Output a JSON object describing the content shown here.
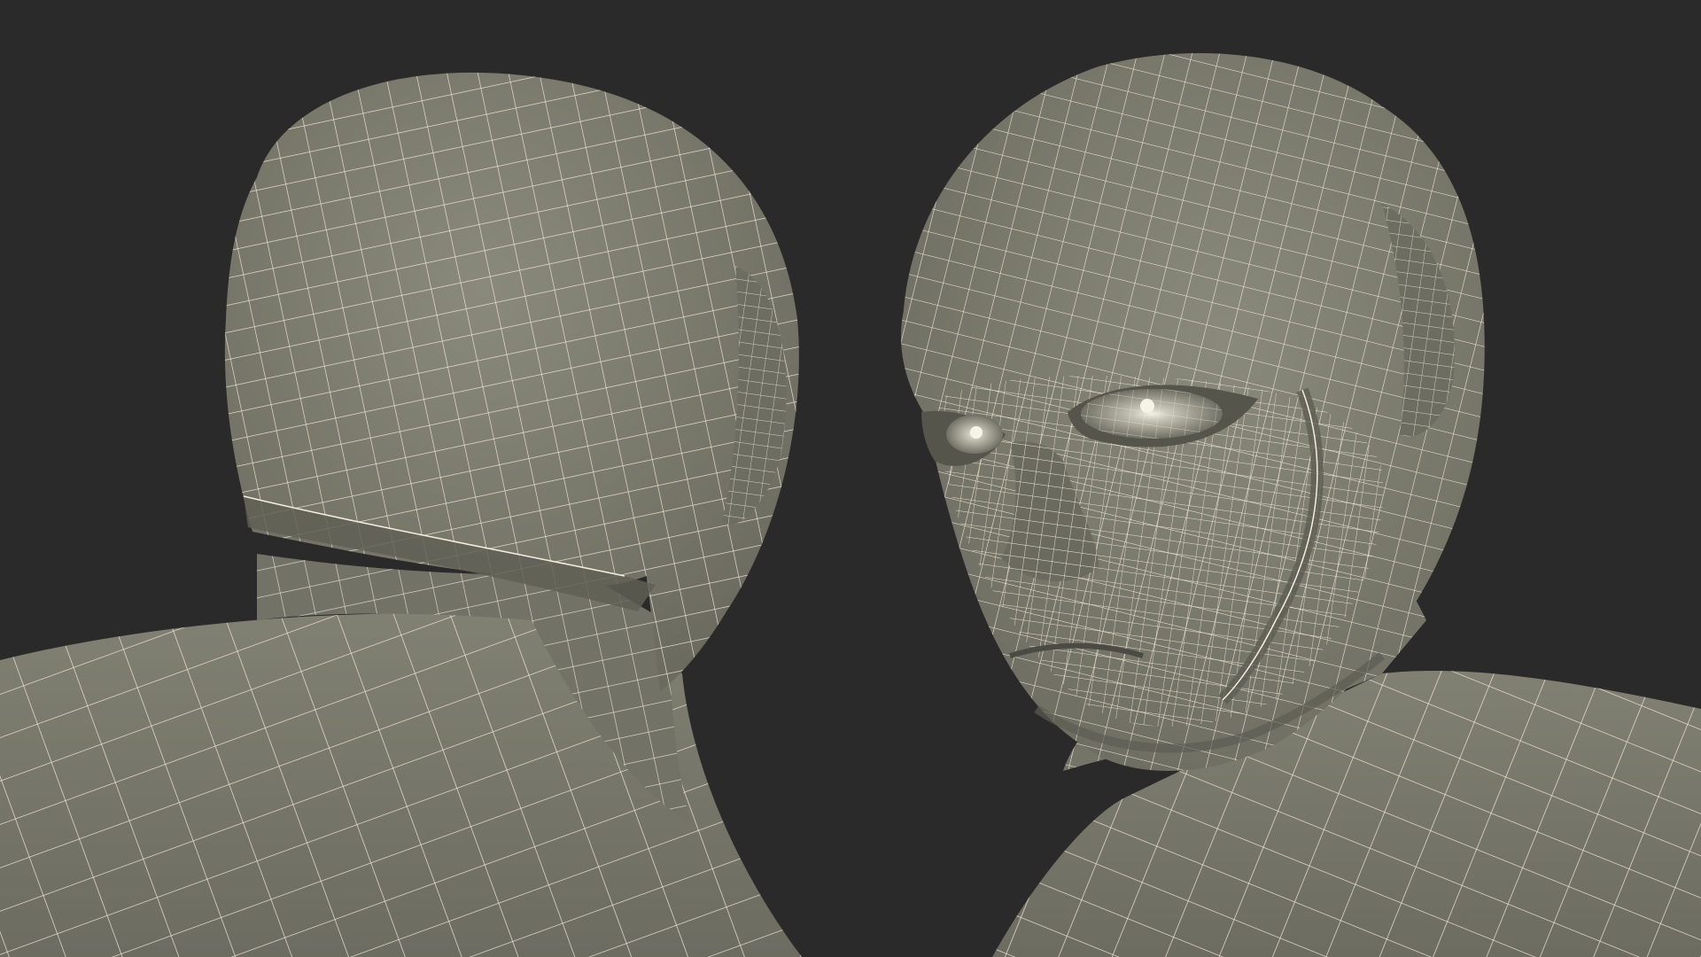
{
  "scene": {
    "background_color": "#2a2a2a",
    "mesh_fill_color": "#7c7c6f",
    "mesh_shade_color": "#5f5f55",
    "wire_color": "#f1efe0",
    "models": [
      {
        "name": "head-back-view",
        "view": "back"
      },
      {
        "name": "head-front-view",
        "view": "three-quarter-front"
      }
    ]
  }
}
